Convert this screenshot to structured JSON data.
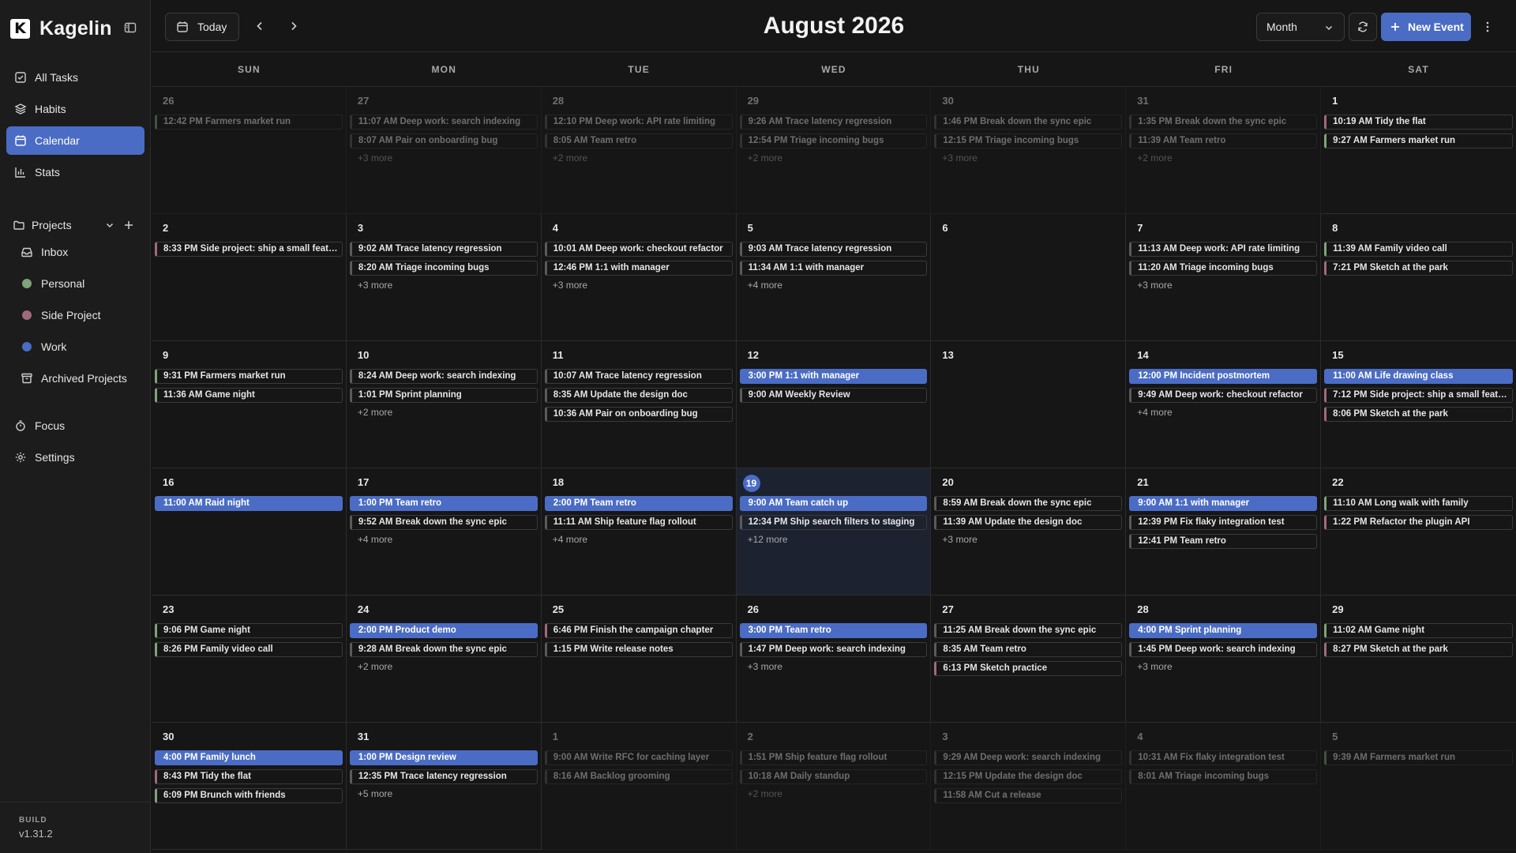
{
  "app": {
    "name": "Kagelin",
    "logo_letter": "K"
  },
  "sidebar": {
    "nav": [
      {
        "label": "All Tasks",
        "icon": "checkbox-icon",
        "active": false
      },
      {
        "label": "Habits",
        "icon": "layers-icon",
        "active": false
      },
      {
        "label": "Calendar",
        "icon": "calendar-icon",
        "active": true
      },
      {
        "label": "Stats",
        "icon": "bar-chart-icon",
        "active": false
      }
    ],
    "projects_label": "Projects",
    "projects": [
      {
        "label": "Inbox",
        "type": "icon",
        "icon": "inbox-icon"
      },
      {
        "label": "Personal",
        "type": "dot",
        "color": "#7fa37a"
      },
      {
        "label": "Side Project",
        "type": "dot",
        "color": "#a06a7a"
      },
      {
        "label": "Work",
        "type": "dot",
        "color": "#4a6cc4"
      },
      {
        "label": "Archived Projects",
        "type": "icon",
        "icon": "archive-icon"
      }
    ],
    "bottom_nav": [
      {
        "label": "Focus",
        "icon": "timer-icon"
      },
      {
        "label": "Settings",
        "icon": "gear-icon"
      }
    ],
    "build": {
      "label": "BUILD",
      "version": "v1.31.2"
    }
  },
  "toolbar": {
    "today_label": "Today",
    "title": "August 2026",
    "view": "Month",
    "new_event_label": "New Event"
  },
  "colors": {
    "accent": "#4a6cc4"
  },
  "weekdays": [
    "SUN",
    "MON",
    "TUE",
    "WED",
    "THU",
    "FRI",
    "SAT"
  ],
  "days": [
    {
      "n": "26",
      "outside": true,
      "events": [
        {
          "t": "12:42 PM Farmers market run",
          "c": "#7fa37a"
        }
      ]
    },
    {
      "n": "27",
      "outside": true,
      "events": [
        {
          "t": "11:07 AM Deep work: search indexing",
          "c": "#5a5a5a"
        },
        {
          "t": "8:07 AM Pair on onboarding bug",
          "c": "#5a5a5a"
        }
      ],
      "more": "+3 more"
    },
    {
      "n": "28",
      "outside": true,
      "events": [
        {
          "t": "12:10 PM Deep work: API rate limiting",
          "c": "#5a5a5a"
        },
        {
          "t": "8:05 AM Team retro",
          "c": "#5a5a5a"
        }
      ],
      "more": "+2 more"
    },
    {
      "n": "29",
      "outside": true,
      "events": [
        {
          "t": "9:26 AM Trace latency regression",
          "c": "#5a5a5a"
        },
        {
          "t": "12:54 PM Triage incoming bugs",
          "c": "#5a5a5a"
        }
      ],
      "more": "+2 more"
    },
    {
      "n": "30",
      "outside": true,
      "events": [
        {
          "t": "1:46 PM Break down the sync epic",
          "c": "#5a5a5a"
        },
        {
          "t": "12:15 PM Triage incoming bugs",
          "c": "#5a5a5a"
        }
      ],
      "more": "+3 more"
    },
    {
      "n": "31",
      "outside": true,
      "events": [
        {
          "t": "1:35 PM Break down the sync epic",
          "c": "#5a5a5a"
        },
        {
          "t": "11:39 AM Team retro",
          "c": "#5a5a5a"
        }
      ],
      "more": "+2 more"
    },
    {
      "n": "1",
      "events": [
        {
          "t": "10:19 AM Tidy the flat",
          "c": "#a06a7a"
        },
        {
          "t": "9:27 AM Farmers market run",
          "c": "#7fa37a"
        }
      ]
    },
    {
      "n": "2",
      "events": [
        {
          "t": "8:33 PM Side project: ship a small feature",
          "c": "#a06a7a"
        }
      ]
    },
    {
      "n": "3",
      "events": [
        {
          "t": "9:02 AM Trace latency regression",
          "c": "#5a5a5a"
        },
        {
          "t": "8:20 AM Triage incoming bugs",
          "c": "#5a5a5a"
        }
      ],
      "more": "+3 more"
    },
    {
      "n": "4",
      "events": [
        {
          "t": "10:01 AM Deep work: checkout refactor",
          "c": "#5a5a5a"
        },
        {
          "t": "12:46 PM 1:1 with manager",
          "c": "#5a5a5a"
        }
      ],
      "more": "+3 more"
    },
    {
      "n": "5",
      "events": [
        {
          "t": "9:03 AM Trace latency regression",
          "c": "#5a5a5a"
        },
        {
          "t": "11:34 AM 1:1 with manager",
          "c": "#5a5a5a"
        }
      ],
      "more": "+4 more"
    },
    {
      "n": "6",
      "events": []
    },
    {
      "n": "7",
      "events": [
        {
          "t": "11:13 AM Deep work: API rate limiting",
          "c": "#5a5a5a"
        },
        {
          "t": "11:20 AM Triage incoming bugs",
          "c": "#5a5a5a"
        }
      ],
      "more": "+3 more"
    },
    {
      "n": "8",
      "events": [
        {
          "t": "11:39 AM Family video call",
          "c": "#7fa37a"
        },
        {
          "t": "7:21 PM Sketch at the park",
          "c": "#a06a7a"
        }
      ]
    },
    {
      "n": "9",
      "events": [
        {
          "t": "9:31 PM Farmers market run",
          "c": "#7fa37a"
        },
        {
          "t": "11:36 AM Game night",
          "c": "#7fa37a"
        }
      ]
    },
    {
      "n": "10",
      "events": [
        {
          "t": "8:24 AM Deep work: search indexing",
          "c": "#5a5a5a"
        },
        {
          "t": "1:01 PM Sprint planning",
          "c": "#5a5a5a"
        }
      ],
      "more": "+2 more"
    },
    {
      "n": "11",
      "events": [
        {
          "t": "10:07 AM Trace latency regression",
          "c": "#5a5a5a"
        },
        {
          "t": "8:35 AM Update the design doc",
          "c": "#5a5a5a"
        },
        {
          "t": "10:36 AM Pair on onboarding bug",
          "c": "#5a5a5a"
        }
      ]
    },
    {
      "n": "12",
      "events": [
        {
          "t": "3:00 PM 1:1 with manager",
          "filled": true
        },
        {
          "t": "9:00 AM Weekly Review",
          "c": "#5a5a5a"
        }
      ]
    },
    {
      "n": "13",
      "events": []
    },
    {
      "n": "14",
      "events": [
        {
          "t": "12:00 PM Incident postmortem",
          "filled": true
        },
        {
          "t": "9:49 AM Deep work: checkout refactor",
          "c": "#5a5a5a"
        }
      ],
      "more": "+4 more"
    },
    {
      "n": "15",
      "events": [
        {
          "t": "11:00 AM Life drawing class",
          "filled": true
        },
        {
          "t": "7:12 PM Side project: ship a small feature",
          "c": "#a06a7a"
        },
        {
          "t": "8:06 PM Sketch at the park",
          "c": "#a06a7a"
        }
      ]
    },
    {
      "n": "16",
      "events": [
        {
          "t": "11:00 AM Raid night",
          "filled": true
        }
      ]
    },
    {
      "n": "17",
      "events": [
        {
          "t": "1:00 PM Team retro",
          "filled": true
        },
        {
          "t": "9:52 AM Break down the sync epic",
          "c": "#5a5a5a"
        }
      ],
      "more": "+4 more"
    },
    {
      "n": "18",
      "events": [
        {
          "t": "2:00 PM Team retro",
          "filled": true
        },
        {
          "t": "11:11 AM Ship feature flag rollout",
          "c": "#5a5a5a"
        }
      ],
      "more": "+4 more"
    },
    {
      "n": "19",
      "today": true,
      "events": [
        {
          "t": "9:00 AM Team catch up",
          "filled": true
        },
        {
          "t": "12:34 PM Ship search filters to staging",
          "c": "#5a5a5a"
        }
      ],
      "more": "+12 more"
    },
    {
      "n": "20",
      "events": [
        {
          "t": "8:59 AM Break down the sync epic",
          "c": "#5a5a5a"
        },
        {
          "t": "11:39 AM Update the design doc",
          "c": "#5a5a5a"
        }
      ],
      "more": "+3 more"
    },
    {
      "n": "21",
      "events": [
        {
          "t": "9:00 AM 1:1 with manager",
          "filled": true
        },
        {
          "t": "12:39 PM Fix flaky integration test",
          "c": "#5a5a5a"
        },
        {
          "t": "12:41 PM Team retro",
          "c": "#5a5a5a"
        }
      ]
    },
    {
      "n": "22",
      "events": [
        {
          "t": "11:10 AM Long walk with family",
          "c": "#7fa37a"
        },
        {
          "t": "1:22 PM Refactor the plugin API",
          "c": "#a06a7a"
        }
      ]
    },
    {
      "n": "23",
      "events": [
        {
          "t": "9:06 PM Game night",
          "c": "#7fa37a"
        },
        {
          "t": "8:26 PM Family video call",
          "c": "#7fa37a"
        }
      ]
    },
    {
      "n": "24",
      "events": [
        {
          "t": "2:00 PM Product demo",
          "filled": true
        },
        {
          "t": "9:28 AM Break down the sync epic",
          "c": "#5a5a5a"
        }
      ],
      "more": "+2 more"
    },
    {
      "n": "25",
      "events": [
        {
          "t": "6:46 PM Finish the campaign chapter",
          "c": "#a06a7a"
        },
        {
          "t": "1:15 PM Write release notes",
          "c": "#5a5a5a"
        }
      ]
    },
    {
      "n": "26",
      "events": [
        {
          "t": "3:00 PM Team retro",
          "filled": true
        },
        {
          "t": "1:47 PM Deep work: search indexing",
          "c": "#5a5a5a"
        }
      ],
      "more": "+3 more"
    },
    {
      "n": "27",
      "events": [
        {
          "t": "11:25 AM Break down the sync epic",
          "c": "#5a5a5a"
        },
        {
          "t": "8:35 AM Team retro",
          "c": "#5a5a5a"
        },
        {
          "t": "6:13 PM Sketch practice",
          "c": "#a06a7a"
        }
      ]
    },
    {
      "n": "28",
      "events": [
        {
          "t": "4:00 PM Sprint planning",
          "filled": true
        },
        {
          "t": "1:45 PM Deep work: search indexing",
          "c": "#5a5a5a"
        }
      ],
      "more": "+3 more"
    },
    {
      "n": "29",
      "events": [
        {
          "t": "11:02 AM Game night",
          "c": "#7fa37a"
        },
        {
          "t": "8:27 PM Sketch at the park",
          "c": "#a06a7a"
        }
      ]
    },
    {
      "n": "30",
      "events": [
        {
          "t": "4:00 PM Family lunch",
          "filled": true
        },
        {
          "t": "8:43 PM Tidy the flat",
          "c": "#a06a7a"
        },
        {
          "t": "6:09 PM Brunch with friends",
          "c": "#7fa37a"
        }
      ]
    },
    {
      "n": "31",
      "events": [
        {
          "t": "1:00 PM Design review",
          "filled": true
        },
        {
          "t": "12:35 PM Trace latency regression",
          "c": "#5a5a5a"
        }
      ],
      "more": "+5 more"
    },
    {
      "n": "1",
      "outside": true,
      "events": [
        {
          "t": "9:00 AM Write RFC for caching layer",
          "c": "#5a5a5a"
        },
        {
          "t": "8:16 AM Backlog grooming",
          "c": "#5a5a5a"
        }
      ]
    },
    {
      "n": "2",
      "outside": true,
      "events": [
        {
          "t": "1:51 PM Ship feature flag rollout",
          "c": "#5a5a5a"
        },
        {
          "t": "10:18 AM Daily standup",
          "c": "#5a5a5a"
        }
      ],
      "more": "+2 more"
    },
    {
      "n": "3",
      "outside": true,
      "events": [
        {
          "t": "9:29 AM Deep work: search indexing",
          "c": "#5a5a5a"
        },
        {
          "t": "12:15 PM Update the design doc",
          "c": "#5a5a5a"
        },
        {
          "t": "11:58 AM Cut a release",
          "c": "#5a5a5a"
        }
      ]
    },
    {
      "n": "4",
      "outside": true,
      "events": [
        {
          "t": "10:31 AM Fix flaky integration test",
          "c": "#5a5a5a"
        },
        {
          "t": "8:01 AM Triage incoming bugs",
          "c": "#5a5a5a"
        }
      ]
    },
    {
      "n": "5",
      "outside": true,
      "events": [
        {
          "t": "9:39 AM Farmers market run",
          "c": "#7fa37a"
        }
      ]
    }
  ]
}
